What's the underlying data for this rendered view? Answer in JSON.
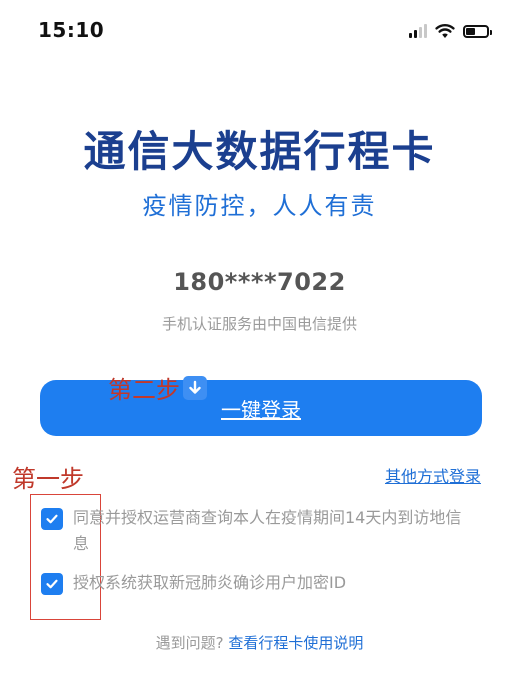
{
  "status_bar": {
    "time": "15:10",
    "signal_bars_filled": 2,
    "signal_bars_total": 4,
    "battery_level": 0.45
  },
  "header": {
    "title": "通信大数据行程卡",
    "subtitle": "疫情防控，人人有责"
  },
  "account": {
    "phone": "180****7022",
    "provider_note": "手机认证服务由中国电信提供"
  },
  "login": {
    "button_label": "一键登录",
    "other_methods": "其他方式登录"
  },
  "annotations": {
    "step_two": "第二步",
    "step_one": "第一步"
  },
  "consents": [
    {
      "text": "同意并授权运营商查询本人在疫情期间14天内到访地信息",
      "checked": true
    },
    {
      "text": "授权系统获取新冠肺炎确诊用户加密ID",
      "checked": true
    }
  ],
  "help": {
    "question": "遇到问题?",
    "link": "查看行程卡使用说明"
  },
  "colors": {
    "primary": "#1e7ef0",
    "title": "#1b3f8f",
    "annotation": "#c0392b"
  }
}
